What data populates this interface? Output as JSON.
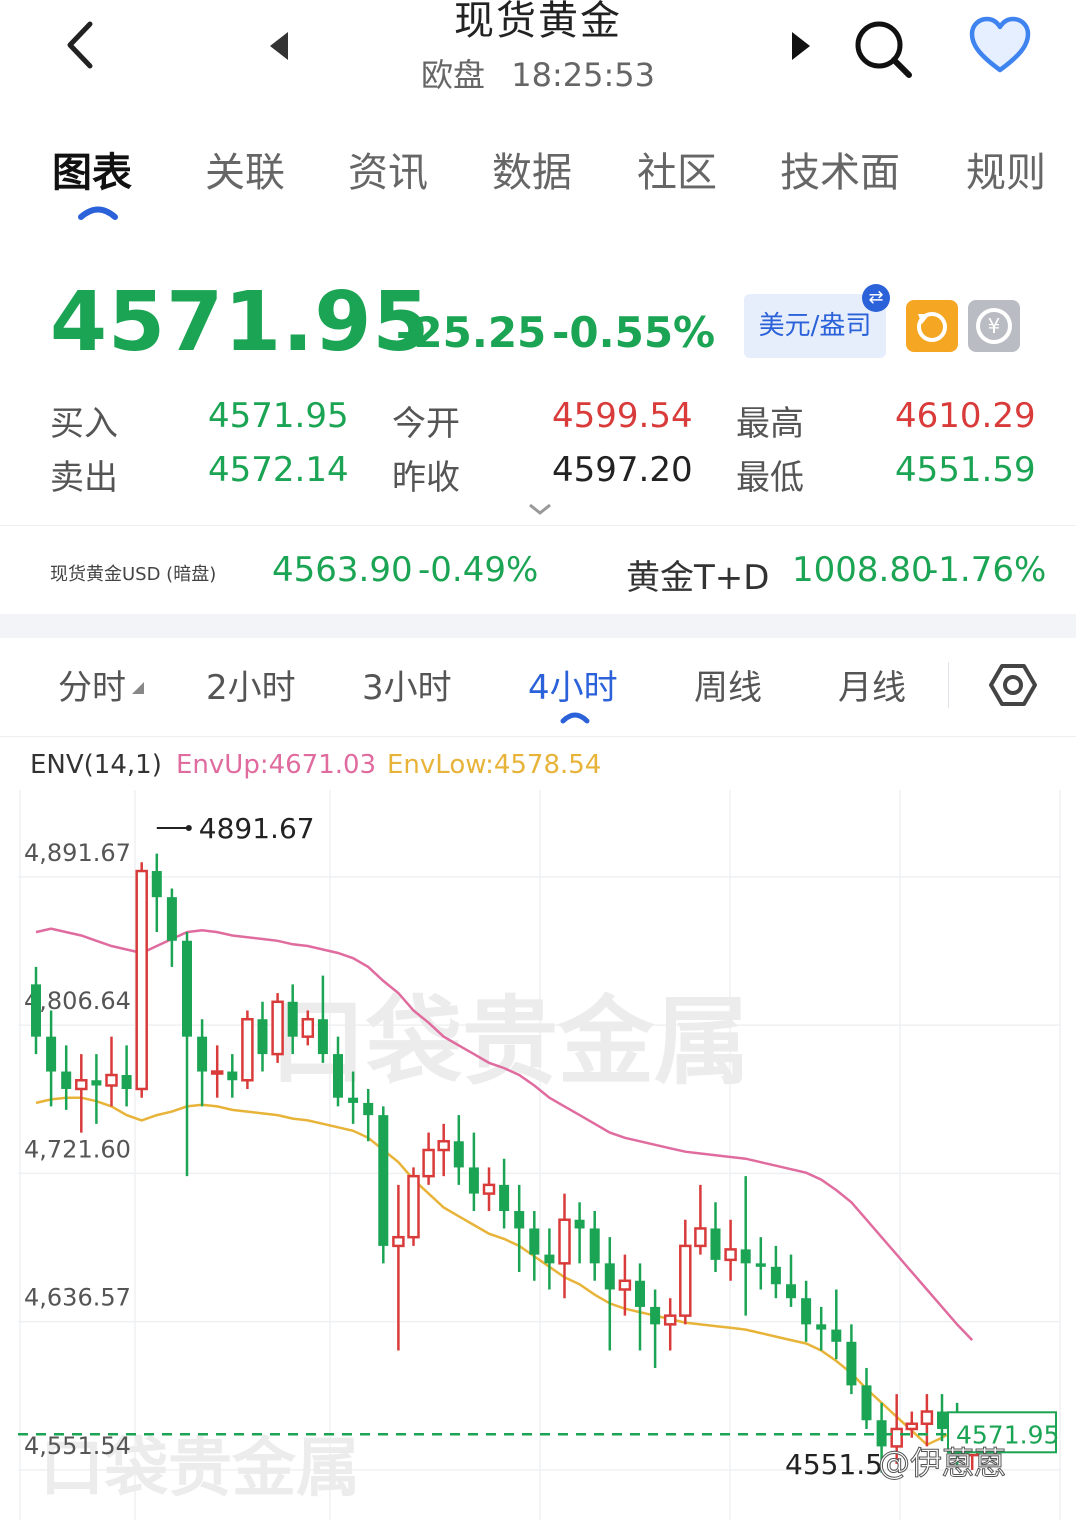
{
  "header": {
    "title": "现货黄金",
    "session": "欧盘",
    "time": "18:25:53"
  },
  "tabs": [
    "图表",
    "关联",
    "资讯",
    "数据",
    "社区",
    "技术面",
    "规则"
  ],
  "quote": {
    "last": "4571.95",
    "change": "-25.25",
    "change_pct": "-0.55%",
    "currency_button": "美元/盎司",
    "bid_label": "买入",
    "bid": "4571.95",
    "ask_label": "卖出",
    "ask": "4572.14",
    "open_label": "今开",
    "open": "4599.54",
    "prev_close_label": "昨收",
    "prev_close": "4597.20",
    "high_label": "最高",
    "high": "4610.29",
    "low_label": "最低",
    "low": "4551.59"
  },
  "reference": {
    "left_name": "现货黄金USD (暗盘)",
    "left_price": "4563.90",
    "left_pct": "-0.49%",
    "right_name": "黄金T+D",
    "right_price": "1008.80",
    "right_pct": "-1.76%"
  },
  "periods": [
    "分时",
    "2小时",
    "3小时",
    "4小时",
    "周线",
    "月线"
  ],
  "active_period": "4小时",
  "indicator": {
    "name": "ENV(14,1)",
    "up": "EnvUp:4671.03",
    "low": "EnvLow:4578.54"
  },
  "colors": {
    "up": "#d93b3b",
    "down": "#1aa453",
    "env_up": "#e06c9f",
    "env_low": "#e8b339",
    "accent": "#2b62d9"
  },
  "chart_data": {
    "type": "candlestick",
    "y_ticks": [
      "4,891.67",
      "4,806.64",
      "4,721.60",
      "4,636.57",
      "4,551.54"
    ],
    "ylim": [
      4540,
      4930
    ],
    "high_marker": "4891.67",
    "low_marker": "4551.5",
    "last_marker": "4571.95",
    "last_value": 4571.95,
    "watermark": "口袋贵金属",
    "credit": "@伊蒽蒽",
    "candles": [
      [
        4830,
        4800,
        4840,
        4790
      ],
      [
        4800,
        4780,
        4815,
        4760
      ],
      [
        4780,
        4770,
        4795,
        4758
      ],
      [
        4770,
        4775,
        4790,
        4745
      ],
      [
        4775,
        4772,
        4790,
        4750
      ],
      [
        4772,
        4778,
        4800,
        4760
      ],
      [
        4778,
        4770,
        4795,
        4760
      ],
      [
        4770,
        4895,
        4900,
        4765
      ],
      [
        4895,
        4880,
        4905,
        4860
      ],
      [
        4880,
        4855,
        4885,
        4840
      ],
      [
        4855,
        4800,
        4860,
        4720
      ],
      [
        4800,
        4780,
        4810,
        4760
      ],
      [
        4780,
        4780,
        4795,
        4765
      ],
      [
        4780,
        4775,
        4790,
        4765
      ],
      [
        4775,
        4810,
        4815,
        4770
      ],
      [
        4810,
        4790,
        4820,
        4780
      ],
      [
        4790,
        4820,
        4825,
        4785
      ],
      [
        4820,
        4800,
        4830,
        4790
      ],
      [
        4800,
        4810,
        4815,
        4795
      ],
      [
        4810,
        4790,
        4835,
        4785
      ],
      [
        4790,
        4765,
        4800,
        4760
      ],
      [
        4765,
        4762,
        4780,
        4750
      ],
      [
        4762,
        4755,
        4770,
        4740
      ],
      [
        4755,
        4680,
        4760,
        4670
      ],
      [
        4680,
        4685,
        4715,
        4620
      ],
      [
        4685,
        4720,
        4725,
        4680
      ],
      [
        4720,
        4735,
        4745,
        4715
      ],
      [
        4735,
        4740,
        4750,
        4720
      ],
      [
        4740,
        4725,
        4755,
        4715
      ],
      [
        4725,
        4710,
        4745,
        4700
      ],
      [
        4710,
        4715,
        4725,
        4700
      ],
      [
        4715,
        4700,
        4730,
        4690
      ],
      [
        4700,
        4690,
        4715,
        4665
      ],
      [
        4690,
        4675,
        4700,
        4660
      ],
      [
        4675,
        4670,
        4690,
        4655
      ],
      [
        4670,
        4695,
        4710,
        4650
      ],
      [
        4695,
        4690,
        4705,
        4670
      ],
      [
        4690,
        4670,
        4700,
        4660
      ],
      [
        4670,
        4655,
        4685,
        4620
      ],
      [
        4655,
        4660,
        4675,
        4640
      ],
      [
        4660,
        4645,
        4670,
        4620
      ],
      [
        4645,
        4635,
        4655,
        4610
      ],
      [
        4635,
        4640,
        4650,
        4620
      ],
      [
        4640,
        4680,
        4695,
        4635
      ],
      [
        4680,
        4690,
        4715,
        4675
      ],
      [
        4690,
        4672,
        4705,
        4665
      ],
      [
        4672,
        4678,
        4695,
        4660
      ],
      [
        4678,
        4670,
        4720,
        4640
      ],
      [
        4670,
        4668,
        4685,
        4655
      ],
      [
        4668,
        4658,
        4680,
        4650
      ],
      [
        4658,
        4650,
        4675,
        4645
      ],
      [
        4650,
        4635,
        4660,
        4625
      ],
      [
        4635,
        4632,
        4645,
        4620
      ],
      [
        4632,
        4625,
        4655,
        4615
      ],
      [
        4625,
        4600,
        4635,
        4595
      ],
      [
        4600,
        4580,
        4610,
        4575
      ],
      [
        4580,
        4565,
        4590,
        4550
      ],
      [
        4565,
        4575,
        4595,
        4555
      ],
      [
        4575,
        4578,
        4585,
        4570
      ],
      [
        4578,
        4585,
        4595,
        4565
      ],
      [
        4585,
        4575,
        4595,
        4568
      ],
      [
        4575,
        4560,
        4590,
        4552
      ],
      [
        4560,
        4571.95,
        4578,
        4551.5
      ]
    ],
    "env_up": [
      4860,
      4862,
      4860,
      4858,
      4855,
      4852,
      4850,
      4848,
      4852,
      4856,
      4860,
      4861,
      4860,
      4858,
      4857,
      4856,
      4855,
      4853,
      4852,
      4850,
      4848,
      4845,
      4840,
      4832,
      4825,
      4815,
      4808,
      4800,
      4795,
      4790,
      4785,
      4782,
      4778,
      4772,
      4765,
      4760,
      4755,
      4750,
      4745,
      4742,
      4740,
      4738,
      4736,
      4734,
      4733,
      4732,
      4731,
      4730,
      4728,
      4726,
      4724,
      4722,
      4718,
      4712,
      4705,
      4695,
      4685,
      4675,
      4665,
      4655,
      4645,
      4635,
      4626
    ],
    "env_low": [
      4762,
      4764,
      4765,
      4765,
      4763,
      4760,
      4755,
      4752,
      4755,
      4757,
      4760,
      4761,
      4760,
      4758,
      4757,
      4756,
      4755,
      4753,
      4752,
      4750,
      4748,
      4746,
      4742,
      4735,
      4728,
      4718,
      4710,
      4702,
      4697,
      4692,
      4687,
      4684,
      4680,
      4674,
      4668,
      4662,
      4658,
      4652,
      4647,
      4644,
      4642,
      4640,
      4638,
      4636,
      4635,
      4634,
      4633,
      4632,
      4630,
      4628,
      4626,
      4624,
      4620,
      4614,
      4607,
      4598,
      4590,
      4582,
      4574,
      4566,
      4570,
      4575,
      4578
    ]
  }
}
